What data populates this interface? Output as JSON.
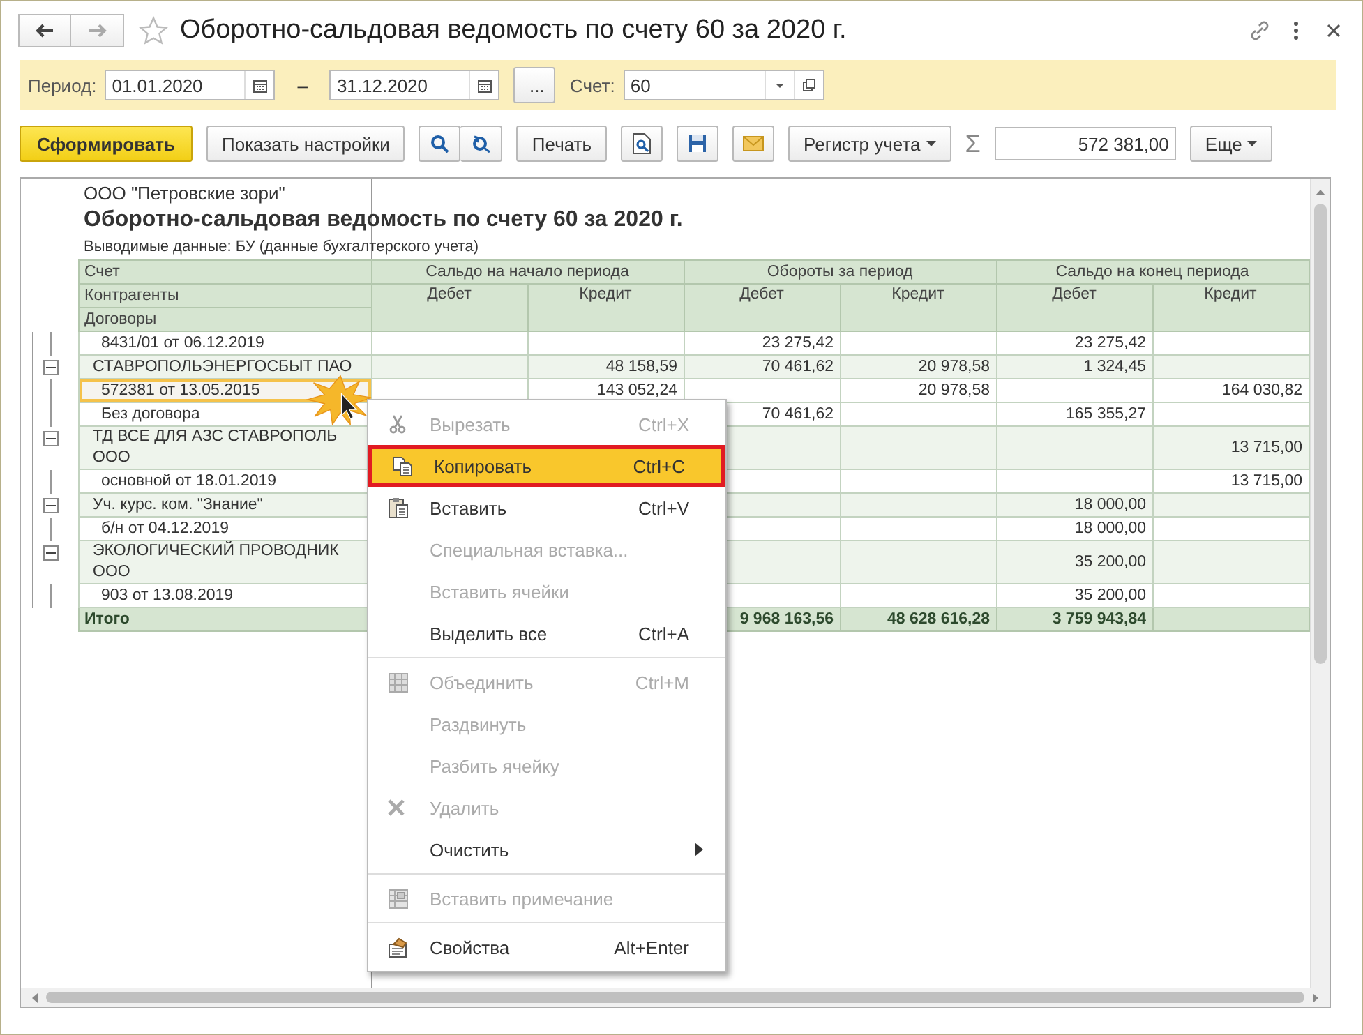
{
  "window": {
    "title": "Оборотно-сальдовая ведомость по счету 60 за 2020 г."
  },
  "period_bar": {
    "period_label": "Период:",
    "date_from": "01.01.2020",
    "dash": "–",
    "date_to": "31.12.2020",
    "more_button": "...",
    "account_label": "Счет:",
    "account": "60"
  },
  "toolbar": {
    "generate_button": "Сформировать",
    "settings_button": "Показать настройки",
    "print_button": "Печать",
    "register_button": "Регистр учета",
    "sum_sign": "Σ",
    "sum_value": "572 381,00",
    "more_button": "Еще"
  },
  "report": {
    "organization": "ООО \"Петровские зори\"",
    "title": "Оборотно-сальдовая ведомость по счету 60 за 2020 г.",
    "subtitle": "Выводимые данные:  БУ (данные бухгалтерского учета)",
    "header": {
      "levels": [
        "Счет",
        "Контрагенты",
        "Договоры"
      ],
      "groups": [
        "Сальдо на начало периода",
        "Обороты за период",
        "Сальдо на конец периода"
      ],
      "sub": [
        "Дебет",
        "Кредит",
        "Дебет",
        "Кредит",
        "Дебет",
        "Кредит"
      ]
    },
    "groups": [
      {
        "children": [
          {
            "name": "8431/01 от 06.12.2019",
            "selected": false,
            "values": {
              "turnover_debit": "23 275,42",
              "closing_debit": "23 275,42"
            }
          }
        ]
      },
      {
        "name": "СТАВРОПОЛЬЭНЕРГОСБЫТ ПАО",
        "expanded": true,
        "selected": false,
        "values": {
          "opening_credit": "48 158,59",
          "turnover_debit": "70 461,62",
          "turnover_credit": "20 978,58",
          "closing_debit": "1 324,45"
        },
        "children": [
          {
            "name": "572381 от 13.05.2015",
            "selected": true,
            "values": {
              "opening_credit": "143 052,24",
              "turnover_credit": "20 978,58",
              "closing_credit": "164 030,82"
            }
          },
          {
            "name": "Без договора",
            "selected": false,
            "values": {
              "turnover_debit": "70 461,62",
              "closing_debit": "165 355,27"
            }
          }
        ]
      },
      {
        "name": "ТД ВСЕ ДЛЯ АЗС СТАВРОПОЛЬ ООО",
        "expanded": true,
        "selected": false,
        "values": {
          "closing_credit": "13 715,00"
        },
        "children": [
          {
            "name": "основной от 18.01.2019",
            "selected": false,
            "values": {
              "closing_credit": "13 715,00"
            }
          }
        ]
      },
      {
        "name": "Уч. курс. ком. \"Знание\"",
        "expanded": true,
        "selected": false,
        "values": {
          "closing_debit": "18 000,00"
        },
        "children": [
          {
            "name": "б/н от 04.12.2019",
            "selected": false,
            "values": {
              "closing_debit": "18 000,00"
            }
          }
        ]
      },
      {
        "name": "ЭКОЛОГИЧЕСКИЙ ПРОВОДНИК ООО",
        "expanded": true,
        "selected": false,
        "values": {
          "closing_debit": "35 200,00"
        },
        "children": [
          {
            "name": "903 от 13.08.2019",
            "selected": false,
            "values": {
              "closing_debit": "35 200,00"
            }
          }
        ]
      }
    ],
    "total": {
      "label": "Итого",
      "values": {
        "turnover_debit": "9 968 163,56",
        "turnover_credit": "48 628 616,28",
        "closing_debit": "3 759 943,84"
      }
    }
  },
  "context_menu": {
    "items": [
      {
        "kind": "item",
        "label": "Вырезать",
        "shortcut": "Ctrl+X",
        "disabled": true,
        "selected": false
      },
      {
        "kind": "item",
        "label": "Копировать",
        "shortcut": "Ctrl+C",
        "disabled": false,
        "selected": true
      },
      {
        "kind": "item",
        "label": "Вставить",
        "shortcut": "Ctrl+V",
        "disabled": false,
        "selected": false
      },
      {
        "kind": "item",
        "label": "Специальная вставка...",
        "disabled": true,
        "selected": false
      },
      {
        "kind": "item",
        "label": "Вставить ячейки",
        "disabled": true,
        "selected": false
      },
      {
        "kind": "item",
        "label": "Выделить все",
        "shortcut": "Ctrl+A",
        "disabled": false,
        "selected": false
      },
      {
        "kind": "separator"
      },
      {
        "kind": "item",
        "label": "Объединить",
        "shortcut": "Ctrl+M",
        "disabled": true,
        "selected": false
      },
      {
        "kind": "item",
        "label": "Раздвинуть",
        "disabled": true,
        "selected": false
      },
      {
        "kind": "item",
        "label": "Разбить ячейку",
        "disabled": true,
        "selected": false
      },
      {
        "kind": "item",
        "label": "Удалить",
        "disabled": true,
        "selected": false
      },
      {
        "kind": "item",
        "label": "Очистить",
        "disabled": false,
        "selected": false,
        "submenu": true
      },
      {
        "kind": "separator"
      },
      {
        "kind": "item",
        "label": "Вставить примечание",
        "disabled": true,
        "selected": false
      },
      {
        "kind": "separator"
      },
      {
        "kind": "item",
        "label": "Свойства",
        "shortcut": "Alt+Enter",
        "disabled": false,
        "selected": false
      }
    ]
  }
}
